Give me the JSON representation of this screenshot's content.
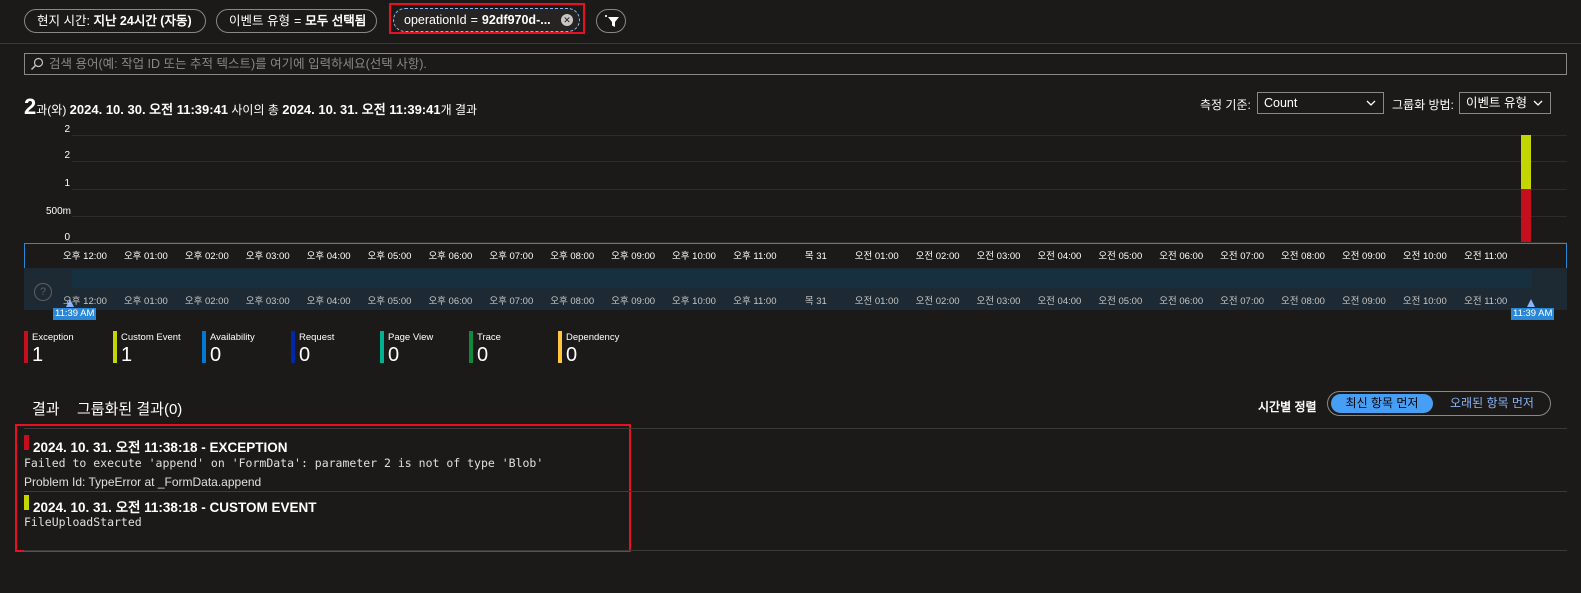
{
  "filters": {
    "time": {
      "label": "현지 시간:",
      "value": "지난 24시간 (자동)"
    },
    "event_type": {
      "label": "이벤트 유형",
      "op": "=",
      "value": "모두 선택됨"
    },
    "operation": {
      "label": "operationId",
      "op": "=",
      "value": "92df970d-..."
    }
  },
  "search": {
    "placeholder": "검색 용어(예: 작업 ID 또는 추적 텍스트)를 여기에 입력하세요(선택 사항)."
  },
  "summary": {
    "count": "2",
    "conj": "과(와)",
    "start": "2024. 10. 30. 오전 11:39:41",
    "between": "사이의 총",
    "end": "2024. 10. 31. 오전 11:39:41",
    "suffix": "개 결과"
  },
  "controls": {
    "measure_label": "측정 기준:",
    "measure_value": "Count",
    "group_label": "그룹화 방법:",
    "group_value": "이벤트 유형"
  },
  "chart_data": {
    "type": "bar",
    "stacked": true,
    "y_ticks": [
      "2",
      "2",
      "1",
      "500m",
      "0"
    ],
    "categories": [
      "오후 12:00",
      "오후 01:00",
      "오후 02:00",
      "오후 03:00",
      "오후 04:00",
      "오후 05:00",
      "오후 06:00",
      "오후 07:00",
      "오후 08:00",
      "오후 09:00",
      "오후 10:00",
      "오후 11:00",
      "목 31",
      "오전 01:00",
      "오전 02:00",
      "오전 03:00",
      "오전 04:00",
      "오전 05:00",
      "오전 06:00",
      "오전 07:00",
      "오전 08:00",
      "오전 09:00",
      "오전 10:00",
      "오전 11:00"
    ],
    "ylim": [
      0,
      2
    ],
    "series": [
      {
        "name": "Exception",
        "color": "#c50f1f",
        "values": [
          0,
          0,
          0,
          0,
          0,
          0,
          0,
          0,
          0,
          0,
          0,
          0,
          0,
          0,
          0,
          0,
          0,
          0,
          0,
          0,
          0,
          0,
          0,
          1
        ]
      },
      {
        "name": "Custom Event",
        "color": "#c4d600",
        "values": [
          0,
          0,
          0,
          0,
          0,
          0,
          0,
          0,
          0,
          0,
          0,
          0,
          0,
          0,
          0,
          0,
          0,
          0,
          0,
          0,
          0,
          0,
          0,
          1
        ]
      }
    ]
  },
  "brush": {
    "start_label": "11:39 AM",
    "end_label": "11:39 AM"
  },
  "legend": [
    {
      "name": "Exception",
      "value": "1",
      "color": "#c50f1f"
    },
    {
      "name": "Custom Event",
      "value": "1",
      "color": "#c4d600"
    },
    {
      "name": "Availability",
      "value": "0",
      "color": "#0078d4"
    },
    {
      "name": "Request",
      "value": "0",
      "color": "#0027a8"
    },
    {
      "name": "Page View",
      "value": "0",
      "color": "#00b294"
    },
    {
      "name": "Trace",
      "value": "0",
      "color": "#10893e"
    },
    {
      "name": "Dependency",
      "value": "0",
      "color": "#ffc83d"
    }
  ],
  "tabs": {
    "results": "결과",
    "grouped": "그룹화된 결과(0)"
  },
  "sort": {
    "label": "시간별 정렬",
    "newest": "최신 항목 먼저",
    "oldest": "오래된 항목 먼저"
  },
  "results": [
    {
      "title": "2024. 10. 31. 오전 11:38:18 - EXCEPTION",
      "color": "#c50f1f",
      "message": "Failed to execute 'append' on 'FormData': parameter 2 is not of type 'Blob'",
      "problem": "Problem Id: TypeError at _FormData.append"
    },
    {
      "title": "2024. 10. 31. 오전 11:38:18 - CUSTOM EVENT",
      "color": "#c4d600",
      "message": "FileUploadStarted"
    }
  ]
}
